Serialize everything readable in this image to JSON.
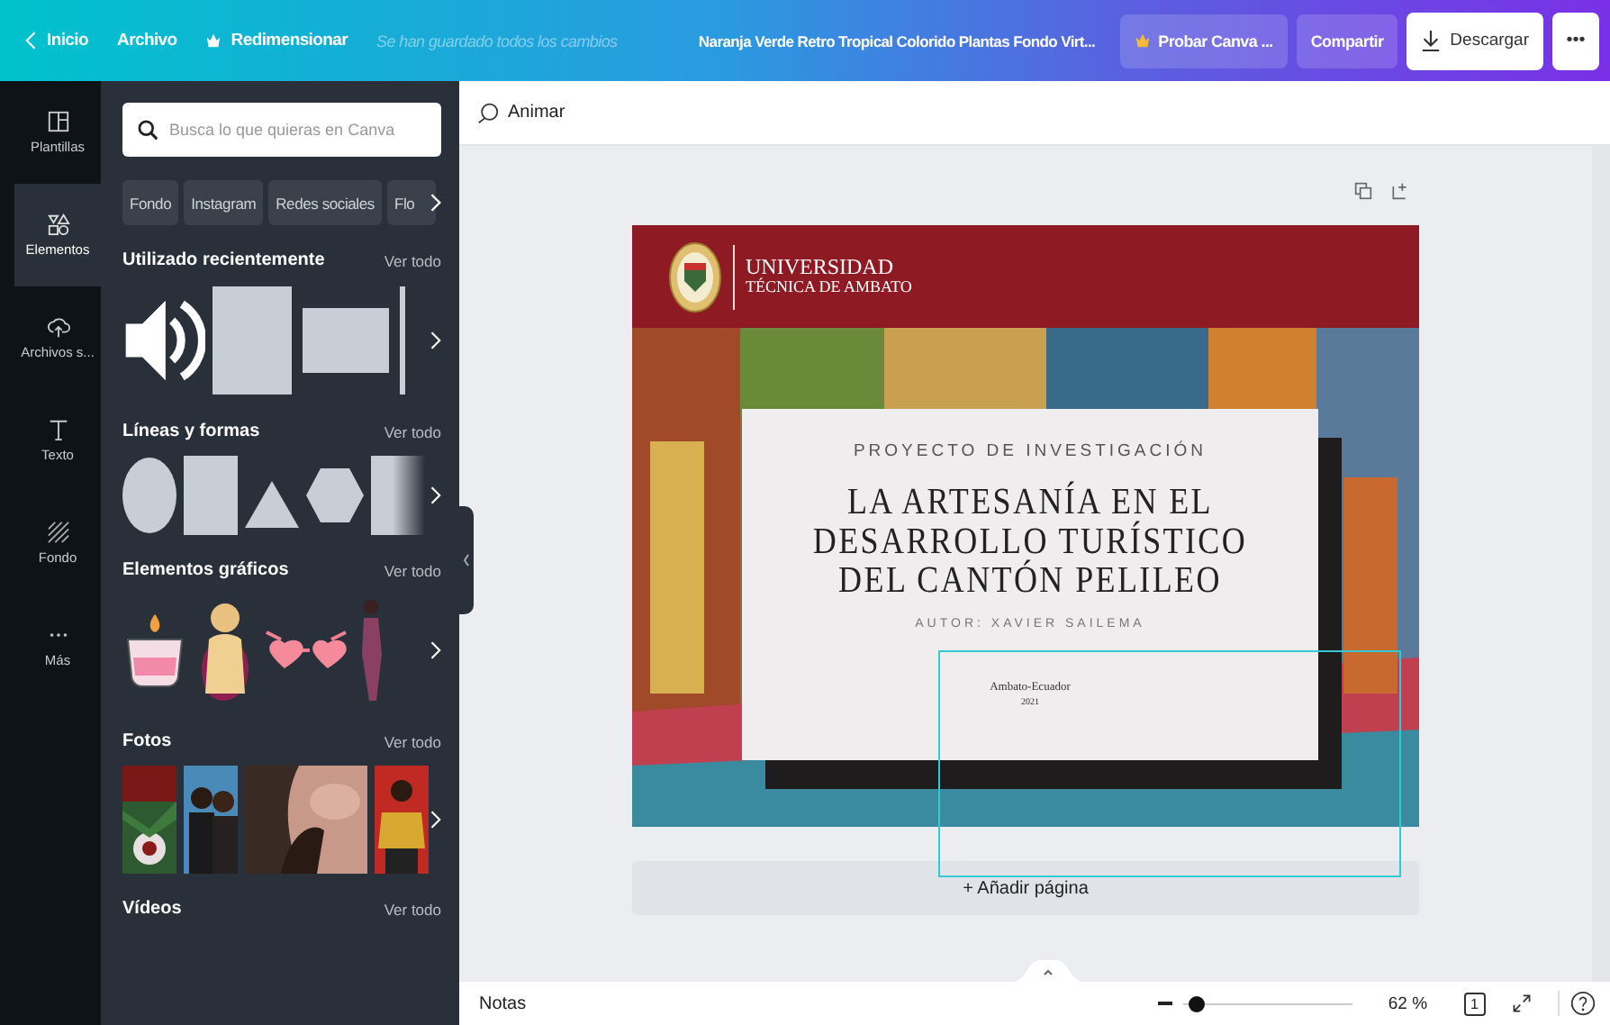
{
  "topbar": {
    "back": "Inicio",
    "file": "Archivo",
    "resize": "Redimensionar",
    "status": "Se han guardado todos los cambios",
    "title": "Naranja Verde Retro Tropical Colorido Plantas Fondo Virt...",
    "try_pro": "Probar Canva ...",
    "share": "Compartir",
    "download": "Descargar",
    "more": "•••"
  },
  "rail": [
    {
      "label": "Plantillas",
      "kind": "templates",
      "selected": false
    },
    {
      "label": "Elementos",
      "kind": "elements",
      "selected": true
    },
    {
      "label": "Archivos s...",
      "kind": "uploads",
      "selected": false
    },
    {
      "label": "Texto",
      "kind": "text",
      "selected": false
    },
    {
      "label": "Fondo",
      "kind": "background",
      "selected": false
    },
    {
      "label": "Más",
      "kind": "more",
      "selected": false
    }
  ],
  "panel": {
    "search": {
      "placeholder": "Busca lo que quieras en Canva"
    },
    "chips": [
      "Fondo",
      "Instagram",
      "Redes sociales",
      "Flo"
    ],
    "sections": [
      {
        "title": "Utilizado recientemente",
        "link": "Ver todo",
        "kind": "recent"
      },
      {
        "title": "Líneas y formas",
        "link": "Ver todo",
        "kind": "shapes"
      },
      {
        "title": "Elementos gráficos",
        "link": "Ver todo",
        "kind": "graphics"
      },
      {
        "title": "Fotos",
        "link": "Ver todo",
        "kind": "photos"
      },
      {
        "title": "Vídeos",
        "link": "Ver todo",
        "kind": "videos"
      }
    ]
  },
  "toolbar": {
    "animate": "Animar"
  },
  "design": {
    "university": "UNIVERSIDAD",
    "faculty": "TÉCNICA DE AMBATO",
    "kicker": "PROYECTO DE INVESTIGACIÓN",
    "title_lines": [
      "LA ARTESANÍA EN EL",
      "DESARROLLO TURÍSTICO",
      "DEL CANTÓN PELILEO"
    ],
    "author": "AUTOR: XAVIER SAILEMA",
    "place": "Ambato-Ecuador",
    "year": "2021"
  },
  "add_page": "+ Añadir página",
  "bottom": {
    "notes": "Notas",
    "zoom": {
      "level": 0.08
    },
    "zoom_label": "62 %",
    "page_count": "1"
  }
}
